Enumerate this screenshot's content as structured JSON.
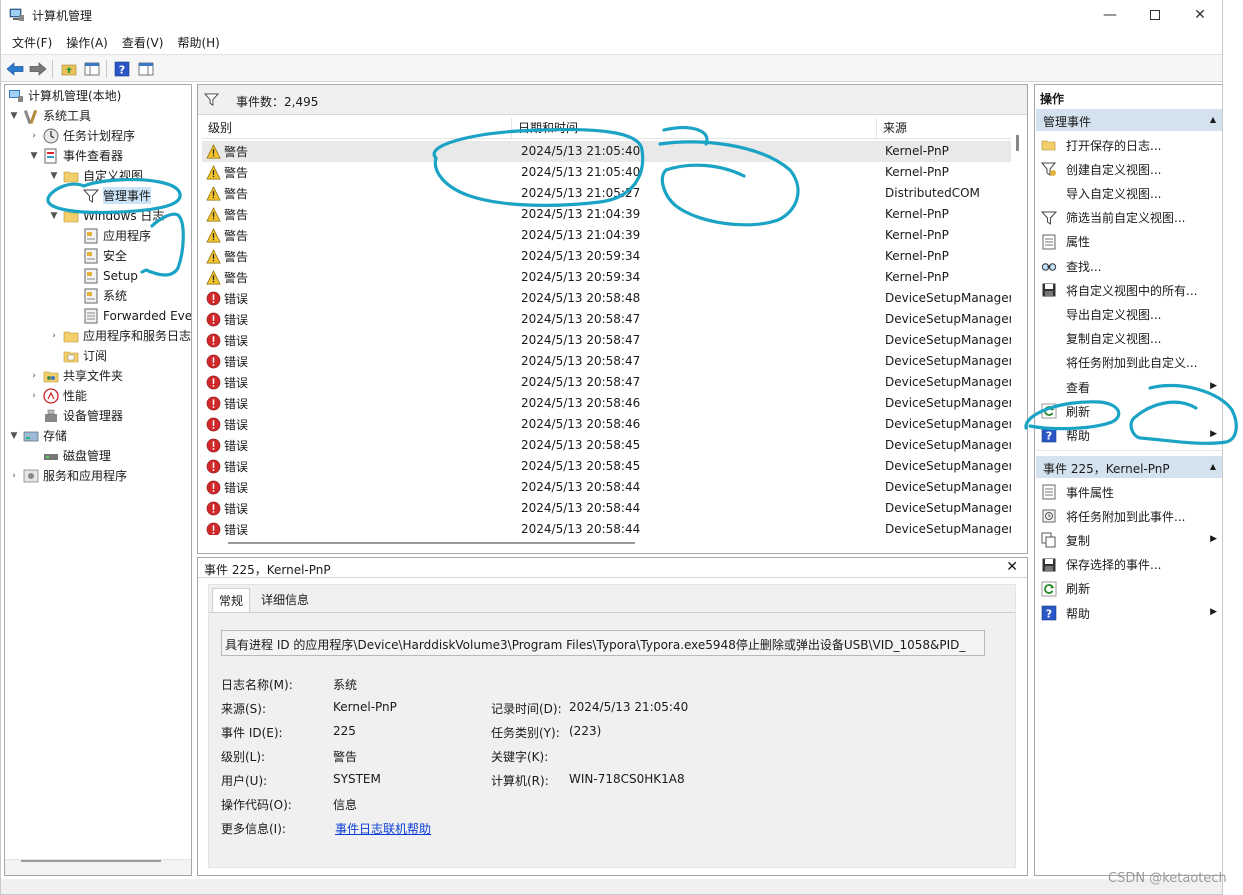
{
  "window": {
    "title": "计算机管理"
  },
  "menu": [
    "文件(F)",
    "操作(A)",
    "查看(V)",
    "帮助(H)"
  ],
  "tree": [
    {
      "label": "计算机管理(本地)",
      "twisty": "",
      "icon": "computer-management-icon"
    },
    {
      "label": "系统工具",
      "twisty": "▼",
      "icon": "tools-icon"
    },
    {
      "label": "任务计划程序",
      "twisty": "›",
      "icon": "task-scheduler-icon"
    },
    {
      "label": "事件查看器",
      "twisty": "▼",
      "icon": "event-viewer-icon"
    },
    {
      "label": "自定义视图",
      "twisty": "▼",
      "icon": "folder-icon"
    },
    {
      "label": "管理事件",
      "twisty": "",
      "icon": "filter-icon"
    },
    {
      "label": "Windows 日志",
      "twisty": "▼",
      "icon": "folder-icon"
    },
    {
      "label": "应用程序",
      "twisty": "",
      "icon": "log-icon"
    },
    {
      "label": "安全",
      "twisty": "",
      "icon": "log-icon"
    },
    {
      "label": "Setup",
      "twisty": "",
      "icon": "log-icon"
    },
    {
      "label": "系统",
      "twisty": "",
      "icon": "log-icon"
    },
    {
      "label": "Forwarded Eve",
      "twisty": "",
      "icon": "log-icon"
    },
    {
      "label": "应用程序和服务日志",
      "twisty": "›",
      "icon": "folder-icon"
    },
    {
      "label": "订阅",
      "twisty": "",
      "icon": "subscription-icon"
    },
    {
      "label": "共享文件夹",
      "twisty": "›",
      "icon": "shared-folder-icon"
    },
    {
      "label": "性能",
      "twisty": "›",
      "icon": "performance-icon"
    },
    {
      "label": "设备管理器",
      "twisty": "",
      "icon": "device-manager-icon"
    },
    {
      "label": "存储",
      "twisty": "▼",
      "icon": "storage-icon"
    },
    {
      "label": "磁盘管理",
      "twisty": "",
      "icon": "disk-icon"
    },
    {
      "label": "服务和应用程序",
      "twisty": "›",
      "icon": "services-icon"
    }
  ],
  "event_list": {
    "count_label": "事件数：2,495",
    "columns": [
      "级别",
      "日期和时间",
      "来源"
    ],
    "rows": [
      {
        "level": "警告",
        "type": "warning",
        "datetime": "2024/5/13 21:05:40",
        "source": "Kernel-PnP"
      },
      {
        "level": "警告",
        "type": "warning",
        "datetime": "2024/5/13 21:05:40",
        "source": "Kernel-PnP"
      },
      {
        "level": "警告",
        "type": "warning",
        "datetime": "2024/5/13 21:05:27",
        "source": "DistributedCOM"
      },
      {
        "level": "警告",
        "type": "warning",
        "datetime": "2024/5/13 21:04:39",
        "source": "Kernel-PnP"
      },
      {
        "level": "警告",
        "type": "warning",
        "datetime": "2024/5/13 21:04:39",
        "source": "Kernel-PnP"
      },
      {
        "level": "警告",
        "type": "warning",
        "datetime": "2024/5/13 20:59:34",
        "source": "Kernel-PnP"
      },
      {
        "level": "警告",
        "type": "warning",
        "datetime": "2024/5/13 20:59:34",
        "source": "Kernel-PnP"
      },
      {
        "level": "错误",
        "type": "error",
        "datetime": "2024/5/13 20:58:48",
        "source": "DeviceSetupManager"
      },
      {
        "level": "错误",
        "type": "error",
        "datetime": "2024/5/13 20:58:47",
        "source": "DeviceSetupManager"
      },
      {
        "level": "错误",
        "type": "error",
        "datetime": "2024/5/13 20:58:47",
        "source": "DeviceSetupManager"
      },
      {
        "level": "错误",
        "type": "error",
        "datetime": "2024/5/13 20:58:47",
        "source": "DeviceSetupManager"
      },
      {
        "level": "错误",
        "type": "error",
        "datetime": "2024/5/13 20:58:47",
        "source": "DeviceSetupManager"
      },
      {
        "level": "错误",
        "type": "error",
        "datetime": "2024/5/13 20:58:46",
        "source": "DeviceSetupManager"
      },
      {
        "level": "错误",
        "type": "error",
        "datetime": "2024/5/13 20:58:46",
        "source": "DeviceSetupManager"
      },
      {
        "level": "错误",
        "type": "error",
        "datetime": "2024/5/13 20:58:45",
        "source": "DeviceSetupManager"
      },
      {
        "level": "错误",
        "type": "error",
        "datetime": "2024/5/13 20:58:45",
        "source": "DeviceSetupManager"
      },
      {
        "level": "错误",
        "type": "error",
        "datetime": "2024/5/13 20:58:44",
        "source": "DeviceSetupManager"
      },
      {
        "level": "错误",
        "type": "error",
        "datetime": "2024/5/13 20:58:44",
        "source": "DeviceSetupManager"
      },
      {
        "level": "错误",
        "type": "error",
        "datetime": "2024/5/13 20:58:44",
        "source": "DeviceSetupManager"
      }
    ]
  },
  "detail": {
    "header": "事件 225，Kernel-PnP",
    "tabs": [
      "常规",
      "详细信息"
    ],
    "message": "具有进程 ID 的应用程序\\Device\\HarddiskVolume3\\Program Files\\Typora\\Typora.exe5948停止删除或弹出设备USB\\VID_1058&PID_",
    "fields": {
      "log_name_label": "日志名称(M):",
      "log_name": "系统",
      "source_label": "来源(S):",
      "source": "Kernel-PnP",
      "logged_label": "记录时间(D):",
      "logged": "2024/5/13 21:05:40",
      "event_id_label": "事件 ID(E):",
      "event_id": "225",
      "task_label": "任务类别(Y):",
      "task": "(223)",
      "level_label": "级别(L):",
      "level": "警告",
      "keywords_label": "关键字(K):",
      "keywords": "",
      "user_label": "用户(U):",
      "user": "SYSTEM",
      "computer_label": "计算机(R):",
      "computer": "WIN-718CS0HK1A8",
      "opcode_label": "操作代码(O):",
      "opcode": "信息",
      "more_info_label": "更多信息(I):",
      "more_info_link": "事件日志联机帮助"
    }
  },
  "actions": {
    "header": "操作",
    "group1": {
      "title": "管理事件",
      "items": [
        {
          "label": "打开保存的日志...",
          "icon": "open-folder-icon",
          "submenu": false
        },
        {
          "label": "创建自定义视图...",
          "icon": "create-filter-icon",
          "submenu": false
        },
        {
          "label": "导入自定义视图...",
          "icon": "",
          "submenu": false
        },
        {
          "label": "筛选当前自定义视图...",
          "icon": "filter-icon",
          "submenu": false
        },
        {
          "label": "属性",
          "icon": "properties-icon",
          "submenu": false
        },
        {
          "label": "查找...",
          "icon": "find-icon",
          "submenu": false
        },
        {
          "label": "将自定义视图中的所有...",
          "icon": "save-icon",
          "submenu": false
        },
        {
          "label": "导出自定义视图...",
          "icon": "",
          "submenu": false
        },
        {
          "label": "复制自定义视图...",
          "icon": "",
          "submenu": false
        },
        {
          "label": "将任务附加到此自定义...",
          "icon": "",
          "submenu": false
        },
        {
          "label": "查看",
          "icon": "",
          "submenu": true
        },
        {
          "label": "刷新",
          "icon": "refresh-icon",
          "submenu": false
        },
        {
          "label": "帮助",
          "icon": "help-icon",
          "submenu": true
        }
      ]
    },
    "group2": {
      "title": "事件 225，Kernel-PnP",
      "items": [
        {
          "label": "事件属性",
          "icon": "properties-icon",
          "submenu": false
        },
        {
          "label": "将任务附加到此事件...",
          "icon": "attach-task-icon",
          "submenu": false
        },
        {
          "label": "复制",
          "icon": "copy-icon",
          "submenu": true
        },
        {
          "label": "保存选择的事件...",
          "icon": "save-icon",
          "submenu": false
        },
        {
          "label": "刷新",
          "icon": "refresh-icon",
          "submenu": false
        },
        {
          "label": "帮助",
          "icon": "help-icon",
          "submenu": true
        }
      ]
    }
  },
  "watermark": "CSDN @ketaotech",
  "annotation_color": "#1aa3c4"
}
